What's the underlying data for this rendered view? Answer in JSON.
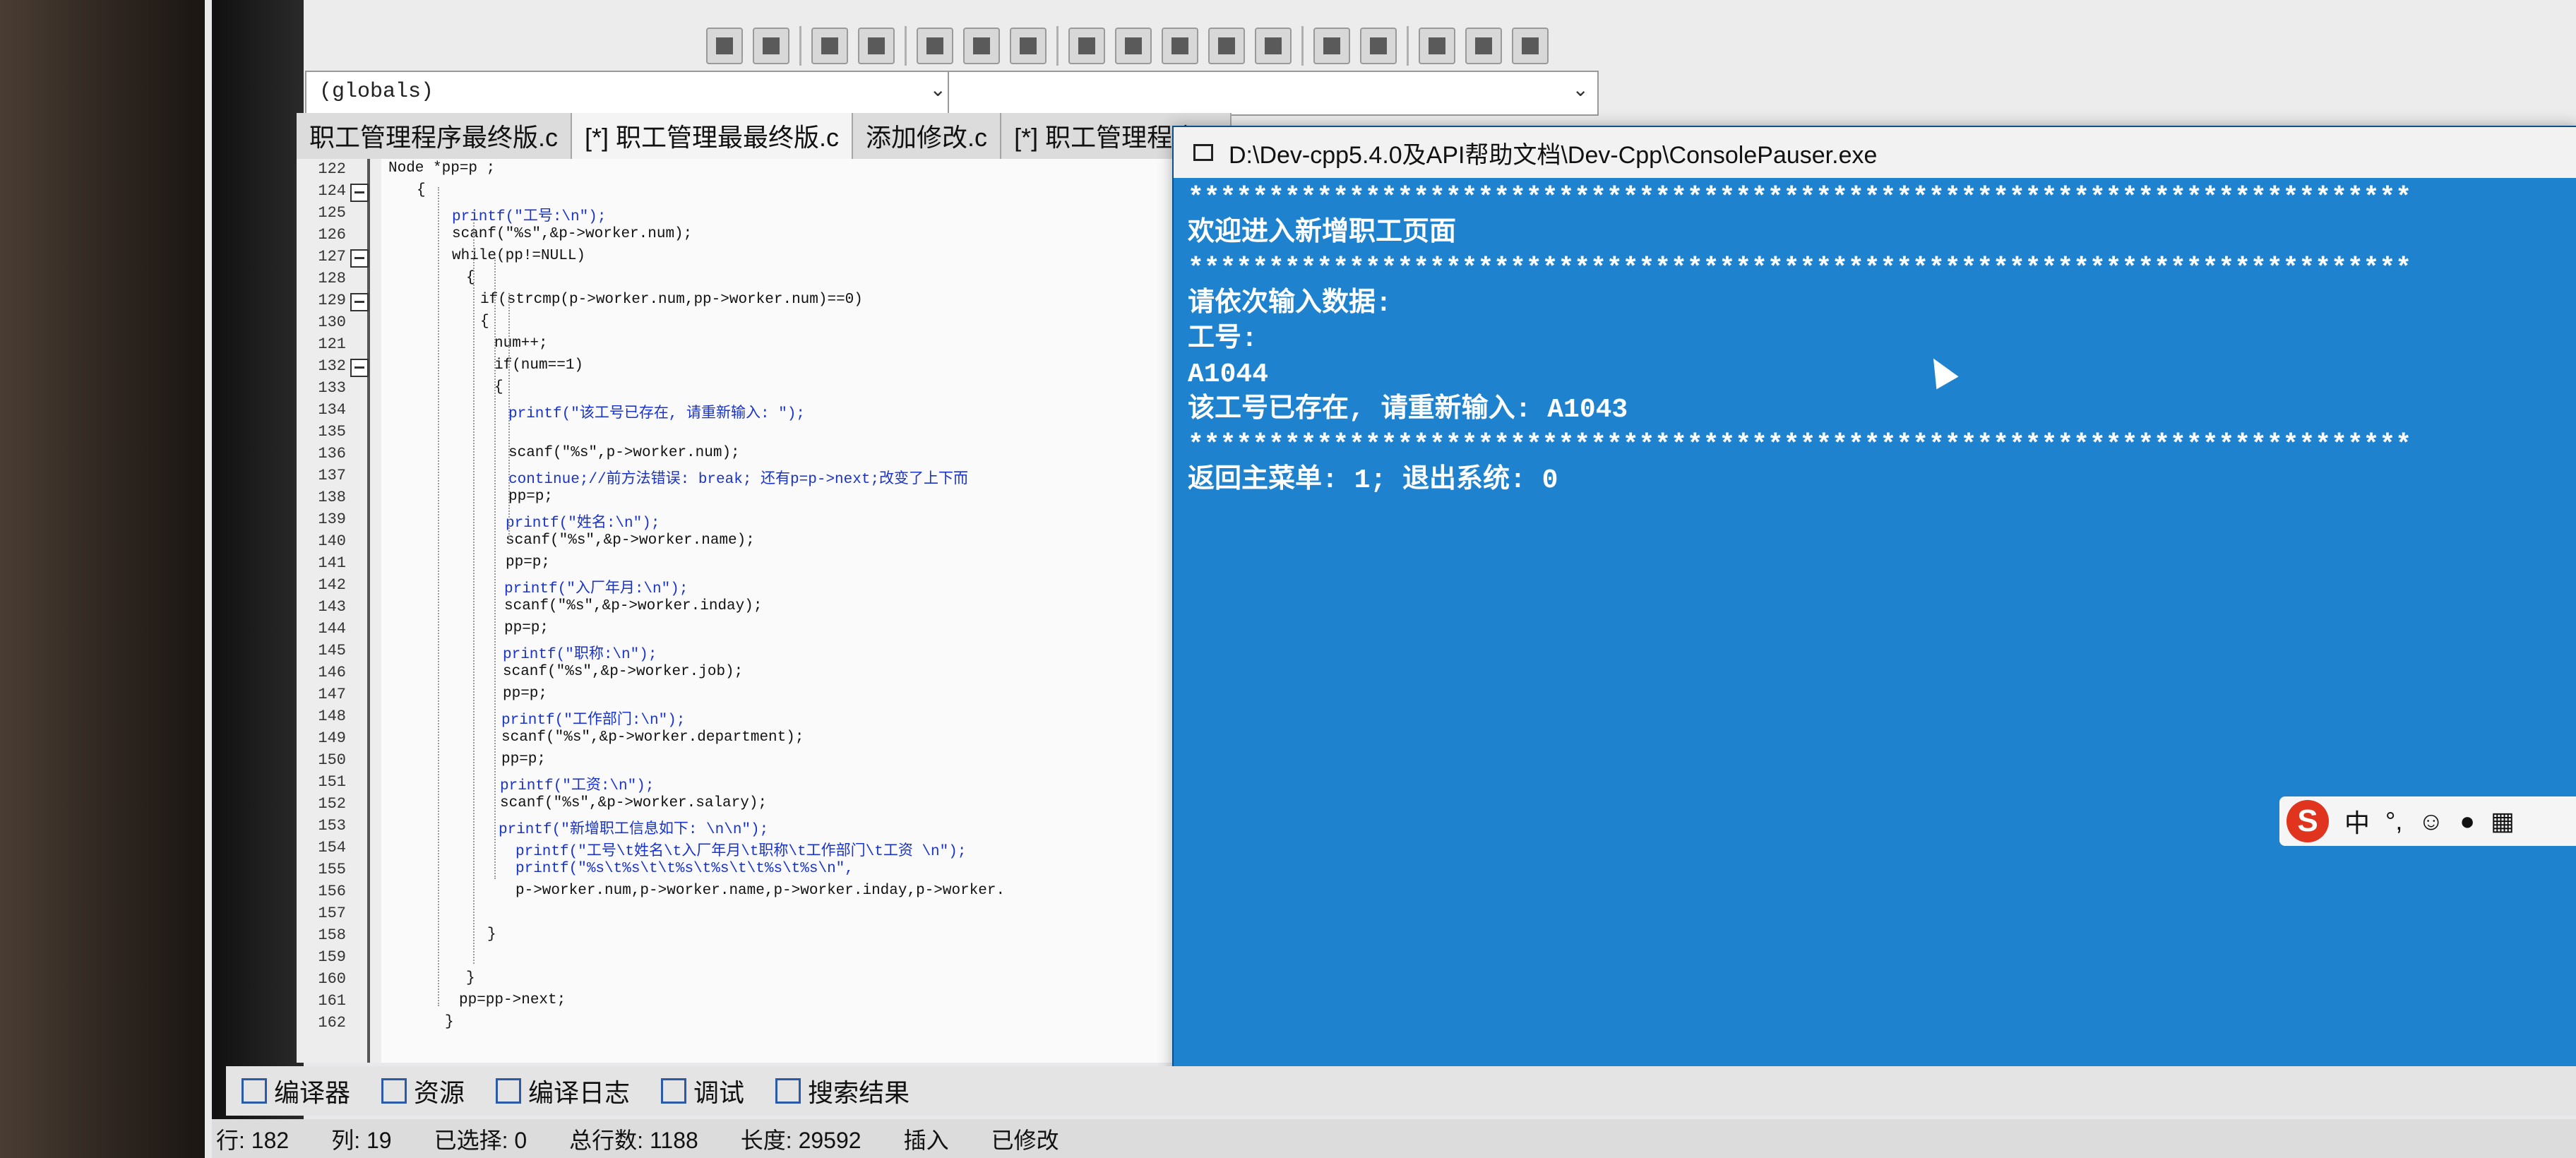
{
  "toolbar": {
    "globals_combo": "(globals)"
  },
  "tabs": [
    {
      "label": "职工管理程序最终版.c"
    },
    {
      "label": "[*] 职工管理最最终版.c"
    },
    {
      "label": "添加修改.c"
    },
    {
      "label": "[*] 职工管理程序.c"
    }
  ],
  "editor": {
    "lines": [
      {
        "n": "122",
        "code": "Node *pp=p ;"
      },
      {
        "n": "124",
        "code": "{"
      },
      {
        "n": "125",
        "code": "printf(\"工号:\\n\");"
      },
      {
        "n": "126",
        "code": "scanf(\"%s\",&p->worker.num);"
      },
      {
        "n": "127",
        "code": "while(pp!=NULL)"
      },
      {
        "n": "128",
        "code": "{"
      },
      {
        "n": "129",
        "code": "if(strcmp(p->worker.num,pp->worker.num)==0)"
      },
      {
        "n": "130",
        "code": "{"
      },
      {
        "n": "121",
        "code": "num++;"
      },
      {
        "n": "132",
        "code": "if(num==1)"
      },
      {
        "n": "133",
        "code": "{"
      },
      {
        "n": "134",
        "code": "printf(\"该工号已存在, 请重新输入: \");"
      },
      {
        "n": "135",
        "code": ""
      },
      {
        "n": "136",
        "code": "scanf(\"%s\",p->worker.num);"
      },
      {
        "n": "137",
        "code": "continue;//前方法错误: break; 还有p=p->next;改变了上下而"
      },
      {
        "n": "138",
        "code": "pp=p;"
      },
      {
        "n": "139",
        "code": "printf(\"姓名:\\n\");"
      },
      {
        "n": "140",
        "code": "scanf(\"%s\",&p->worker.name);"
      },
      {
        "n": "141",
        "code": "pp=p;"
      },
      {
        "n": "142",
        "code": "printf(\"入厂年月:\\n\");"
      },
      {
        "n": "143",
        "code": "scanf(\"%s\",&p->worker.inday);"
      },
      {
        "n": "144",
        "code": "pp=p;"
      },
      {
        "n": "145",
        "code": "printf(\"职称:\\n\");"
      },
      {
        "n": "146",
        "code": "scanf(\"%s\",&p->worker.job);"
      },
      {
        "n": "147",
        "code": "pp=p;"
      },
      {
        "n": "148",
        "code": "printf(\"工作部门:\\n\");"
      },
      {
        "n": "149",
        "code": "scanf(\"%s\",&p->worker.department);"
      },
      {
        "n": "150",
        "code": "pp=p;"
      },
      {
        "n": "151",
        "code": "printf(\"工资:\\n\");"
      },
      {
        "n": "152",
        "code": "scanf(\"%s\",&p->worker.salary);"
      },
      {
        "n": "153",
        "code": "printf(\"新增职工信息如下: \\n\\n\");"
      },
      {
        "n": "154",
        "code": "printf(\"工号\\t姓名\\t入厂年月\\t职称\\t工作部门\\t工资 \\n\");"
      },
      {
        "n": "155",
        "code": "printf(\"%s\\t%s\\t\\t%s\\t%s\\t\\t%s\\t%s\\n\","
      },
      {
        "n": "156",
        "code": "p->worker.num,p->worker.name,p->worker.inday,p->worker."
      },
      {
        "n": "157",
        "code": ""
      },
      {
        "n": "158",
        "code": "}"
      },
      {
        "n": "159",
        "code": ""
      },
      {
        "n": "160",
        "code": "}"
      },
      {
        "n": "161",
        "code": "pp=pp->next;"
      },
      {
        "n": "162",
        "code": "}"
      }
    ]
  },
  "console": {
    "title": "D:\\Dev-cpp5.4.0及API帮助文档\\Dev-Cpp\\ConsolePauser.exe",
    "stars": "****************************************************************************",
    "line_welcome": "欢迎进入新增职工页面",
    "line_prompt": "请依次输入数据:",
    "line_id_label": "工号:",
    "line_input1": "A1044",
    "line_exists": "该工号已存在, 请重新输入: A1043",
    "line_menu": "返回主菜单: 1; 退出系统: 0"
  },
  "ime": {
    "logo": "S",
    "mode": "中"
  },
  "bottom_tabs": [
    {
      "label": "编译器"
    },
    {
      "label": "资源"
    },
    {
      "label": "编译日志"
    },
    {
      "label": "调试"
    },
    {
      "label": "搜索结果"
    }
  ],
  "status": {
    "row_label": "行:",
    "row_value": "182",
    "col_label": "列:",
    "col_value": "19",
    "sel_label": "已选择:",
    "sel_value": "0",
    "total_label": "总行数:",
    "total_value": "1188",
    "len_label": "长度:",
    "len_value": "29592",
    "insert": "插入",
    "modified": "已修改"
  }
}
